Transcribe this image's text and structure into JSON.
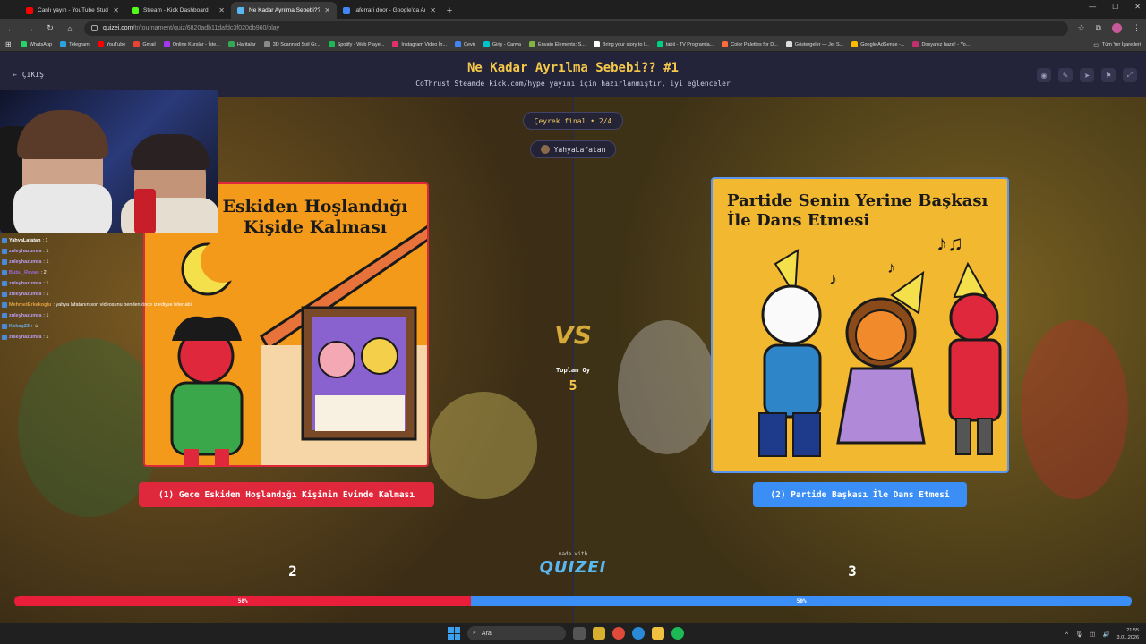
{
  "browser": {
    "tabs": [
      {
        "title": "Canlı yayın - YouTube Studio",
        "color": "#ff0000",
        "active": false
      },
      {
        "title": "Stream - Kick Dashboard",
        "color": "#53fc18",
        "active": false
      },
      {
        "title": "Ne Kadar Ayrılma Sebebi?? #1",
        "color": "#5ab8f0",
        "active": true
      },
      {
        "title": "laferrari door - Google'da Ara",
        "color": "#4285f4",
        "active": false
      }
    ],
    "url_domain": "quizei.com",
    "url_path": "/tr/tournament/quiz/6820adb11dafdc3f020db960/play",
    "bookmarks": [
      {
        "label": "WhatsApp",
        "color": "#25d366"
      },
      {
        "label": "Telegram",
        "color": "#2aa3e0"
      },
      {
        "label": "YouTube",
        "color": "#ff0000"
      },
      {
        "label": "Gmail",
        "color": "#ea4335"
      },
      {
        "label": "Online Kurslar - İste...",
        "color": "#a435f0"
      },
      {
        "label": "Haritalar",
        "color": "#34a853"
      },
      {
        "label": "3D Scanned Soil Gr...",
        "color": "#8a8a8a"
      },
      {
        "label": "Spotify - Web Playe...",
        "color": "#1db954"
      },
      {
        "label": "Instagram Video İn...",
        "color": "#e1306c"
      },
      {
        "label": "Çevir",
        "color": "#4285f4"
      },
      {
        "label": "Giriş - Canva",
        "color": "#00c4cc"
      },
      {
        "label": "Envato Elements: S...",
        "color": "#82b541"
      },
      {
        "label": "Bring your story to l...",
        "color": "#ffffff"
      },
      {
        "label": "tabii - TV Programla...",
        "color": "#00d084"
      },
      {
        "label": "Color Palettes for D...",
        "color": "#ff6a3d"
      },
      {
        "label": "Göstergeler — Jet S...",
        "color": "#dddddd"
      },
      {
        "label": "Google AdSense -...",
        "color": "#fbbc05"
      },
      {
        "label": "Dosyanız hazır! - Yo...",
        "color": "#c0306c"
      }
    ],
    "all_bookmarks": "Tüm Yer İşaretleri"
  },
  "page": {
    "exit_label": "ÇIKIŞ",
    "title": "Ne Kadar Ayrılma Sebebi?? #1",
    "subtitle": "CoThrust Steamde kick.com/hype yayını için hazırlanmıştır, iyi eğlenceler",
    "round": "Çeyrek final • 2/4",
    "creator": "YahyaLafatan",
    "vs_label": "VS",
    "total_label": "Toplam Oy",
    "total_value": "5",
    "made_with": "made with",
    "logo": "QUIZEI",
    "left": {
      "card_title": "Eskiden Hoşlandığı Kişide Kalması",
      "button": "(1) Gece Eskiden Hoşlandığı Kişinin Evinde Kalması",
      "votes": "2",
      "percent_label": "50%",
      "share": 0.409,
      "color": "#e81e3a"
    },
    "right": {
      "card_title": "Partide Senin Yerine Başkası İle Dans Etmesi",
      "button": "(2) Partide Başkası İle Dans Etmesi",
      "votes": "3",
      "percent_label": "50%",
      "share": 0.591,
      "color": "#3b8ef5"
    }
  },
  "chat": [
    {
      "user": "YahyaLafatan",
      "msg": ": 1",
      "color": "#ffffff"
    },
    {
      "user": "zuleyhazumra",
      "msg": ": 1",
      "color": "#b89ef0"
    },
    {
      "user": "zuleyhazumra",
      "msg": ": 1",
      "color": "#b89ef0"
    },
    {
      "user": "Bubu_Revan",
      "msg": ": 2",
      "color": "#9a6ae0"
    },
    {
      "user": "zuleyhazumra",
      "msg": ": 1",
      "color": "#b89ef0"
    },
    {
      "user": "zuleyhazumra",
      "msg": ": 1",
      "color": "#b89ef0"
    },
    {
      "user": "MehmetErkekoglu",
      "msg": ": yahya lafatanın son videosunu benden önce izlediyse biter abi",
      "color": "#e0a040"
    },
    {
      "user": "zuleyhazumra",
      "msg": ": 1",
      "color": "#b89ef0"
    },
    {
      "user": "Kokoş23",
      "msg": ": ☺",
      "color": "#6ab0f0"
    },
    {
      "user": "zuleyhazumra",
      "msg": ": 1",
      "color": "#b89ef0"
    }
  ],
  "taskbar": {
    "search": "Ara",
    "time": "21:55",
    "date": "3.01.2026"
  }
}
